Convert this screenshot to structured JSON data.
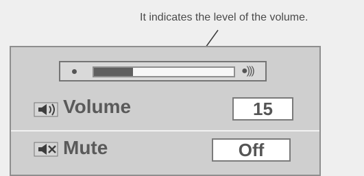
{
  "callout": {
    "text": "It indicates the level of the volume."
  },
  "meter": {
    "level_fraction": 0.28,
    "icon": "speaker-loud-icon"
  },
  "rows": [
    {
      "icon": "speaker-icon",
      "label": "Volume",
      "value": "15"
    },
    {
      "icon": "speaker-muted-icon",
      "label": "Mute",
      "value": "Off"
    }
  ],
  "colors": {
    "panel": "#cfcfcf",
    "fill": "#5f5f5f",
    "text": "#5a5a5a"
  }
}
